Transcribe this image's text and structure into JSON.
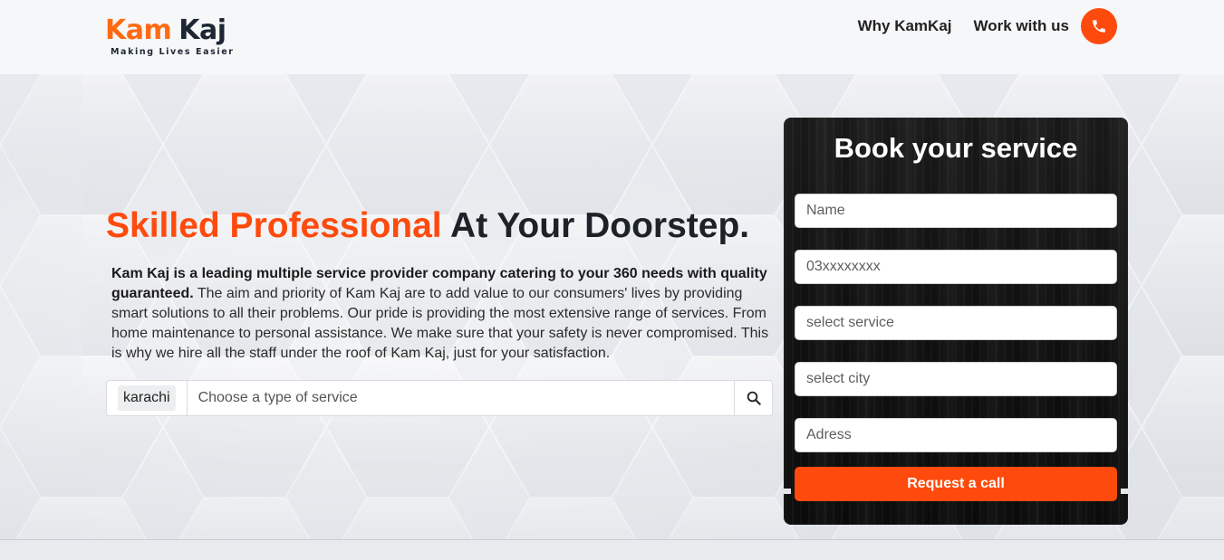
{
  "brand": {
    "logo_part1": "Kam",
    "logo_part2": "Kaj",
    "tagline": "Making Lives Easier",
    "accent_color": "#ff4a0d",
    "logo_orange": "#ff6a13"
  },
  "nav": {
    "items": [
      {
        "label": "Why KamKaj"
      },
      {
        "label": "Work with us"
      }
    ],
    "phone_icon": "phone-icon"
  },
  "hero": {
    "headline_accent": "Skilled Professional",
    "headline_rest": "At Your Doorstep.",
    "description_bold": "Kam Kaj is a leading multiple service provider company catering to your 360 needs with quality guaranteed.",
    "description_rest": " The aim and priority of Kam Kaj are to add value to our consumers' lives by providing smart solutions to all their problems. Our pride is providing the most extensive range of services. From home maintenance to personal assistance. We make sure that your safety is never compromised. This is why we hire all the staff under the roof of Kam Kaj, just for your satisfaction."
  },
  "search": {
    "city": "karachi",
    "placeholder": "Choose a type of service",
    "icon": "search-icon"
  },
  "booking": {
    "title": "Book your service",
    "fields": {
      "name_placeholder": "Name",
      "phone_placeholder": "03xxxxxxxx",
      "service_placeholder": "select service",
      "city_placeholder": "select city",
      "address_placeholder": "Adress"
    },
    "submit_label": "Request a call"
  }
}
